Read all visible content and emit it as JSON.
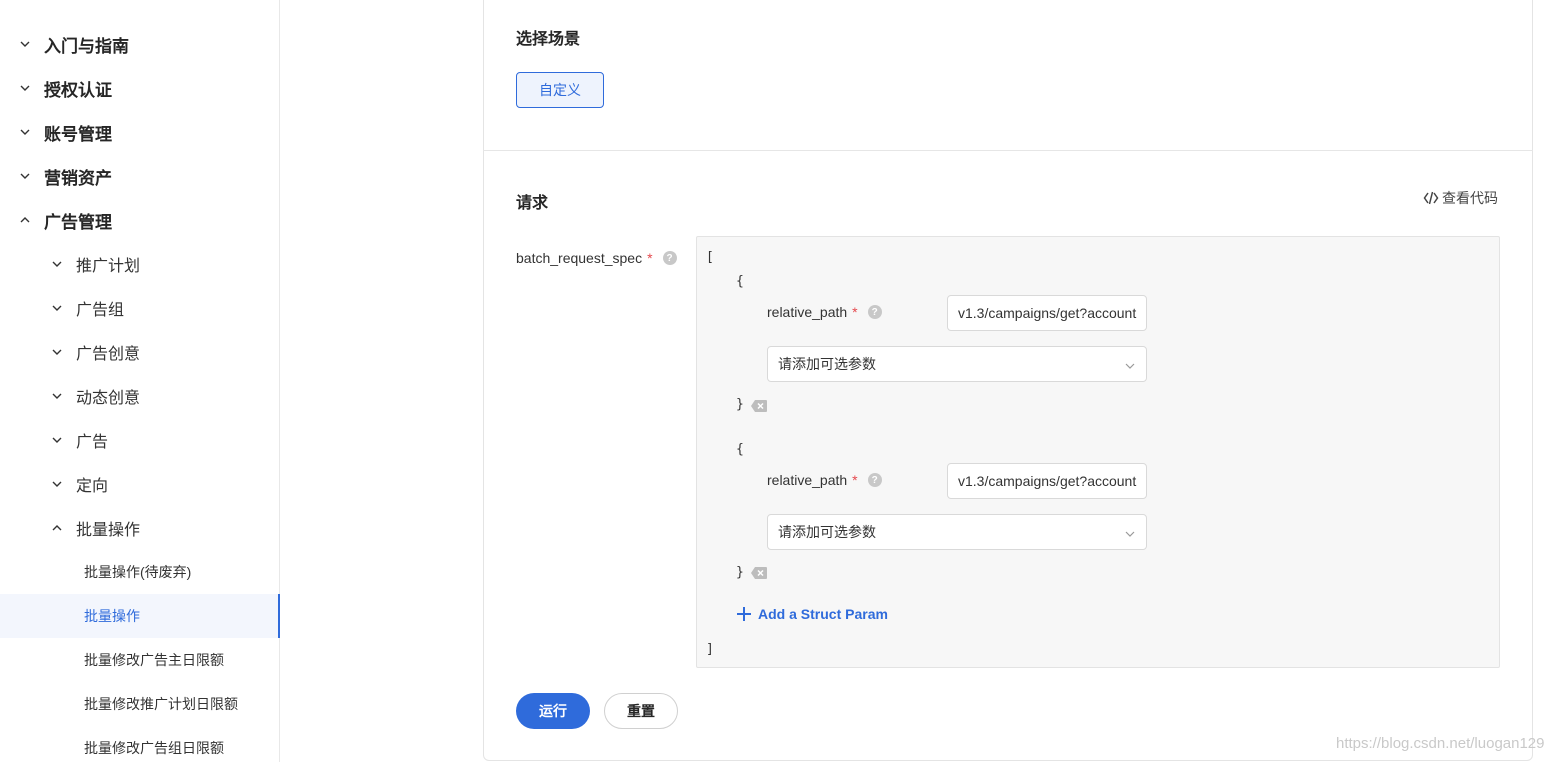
{
  "sidebar": {
    "l1": [
      {
        "label": "入门与指南",
        "expanded": false
      },
      {
        "label": "授权认证",
        "expanded": false
      },
      {
        "label": "账号管理",
        "expanded": false
      },
      {
        "label": "营销资产",
        "expanded": false
      },
      {
        "label": "广告管理",
        "expanded": true
      }
    ],
    "l2": [
      {
        "label": "推广计划",
        "expanded": false
      },
      {
        "label": "广告组",
        "expanded": false
      },
      {
        "label": "广告创意",
        "expanded": false
      },
      {
        "label": "动态创意",
        "expanded": false
      },
      {
        "label": "广告",
        "expanded": false
      },
      {
        "label": "定向",
        "expanded": false
      },
      {
        "label": "批量操作",
        "expanded": true
      }
    ],
    "l3": [
      {
        "label": "批量操作(待废弃)",
        "active": false
      },
      {
        "label": "批量操作",
        "active": true
      },
      {
        "label": "批量修改广告主日限额",
        "active": false
      },
      {
        "label": "批量修改推广计划日限额",
        "active": false
      },
      {
        "label": "批量修改广告组日限额",
        "active": false
      }
    ]
  },
  "scene": {
    "title": "选择场景",
    "button": "自定义"
  },
  "request": {
    "title": "请求",
    "view_code": "查看代码",
    "param_label": "batch_request_spec",
    "required_mark": "*",
    "help_glyph": "?",
    "open_bracket": "[",
    "close_bracket": "]",
    "open_brace": "{",
    "close_brace": "}",
    "items": [
      {
        "field_label": "relative_path",
        "field_value": "v1.3/campaigns/get?account",
        "select_placeholder": "请添加可选参数"
      },
      {
        "field_label": "relative_path",
        "field_value": "v1.3/campaigns/get?account",
        "select_placeholder": "请添加可选参数"
      }
    ],
    "add_struct": "Add a Struct Param"
  },
  "actions": {
    "run": "运行",
    "reset": "重置"
  },
  "watermark": "https://blog.csdn.net/luogan129",
  "colors": {
    "accent": "#2f6bdb",
    "required": "#e5484d",
    "editor_bg": "#f7f7f7"
  }
}
